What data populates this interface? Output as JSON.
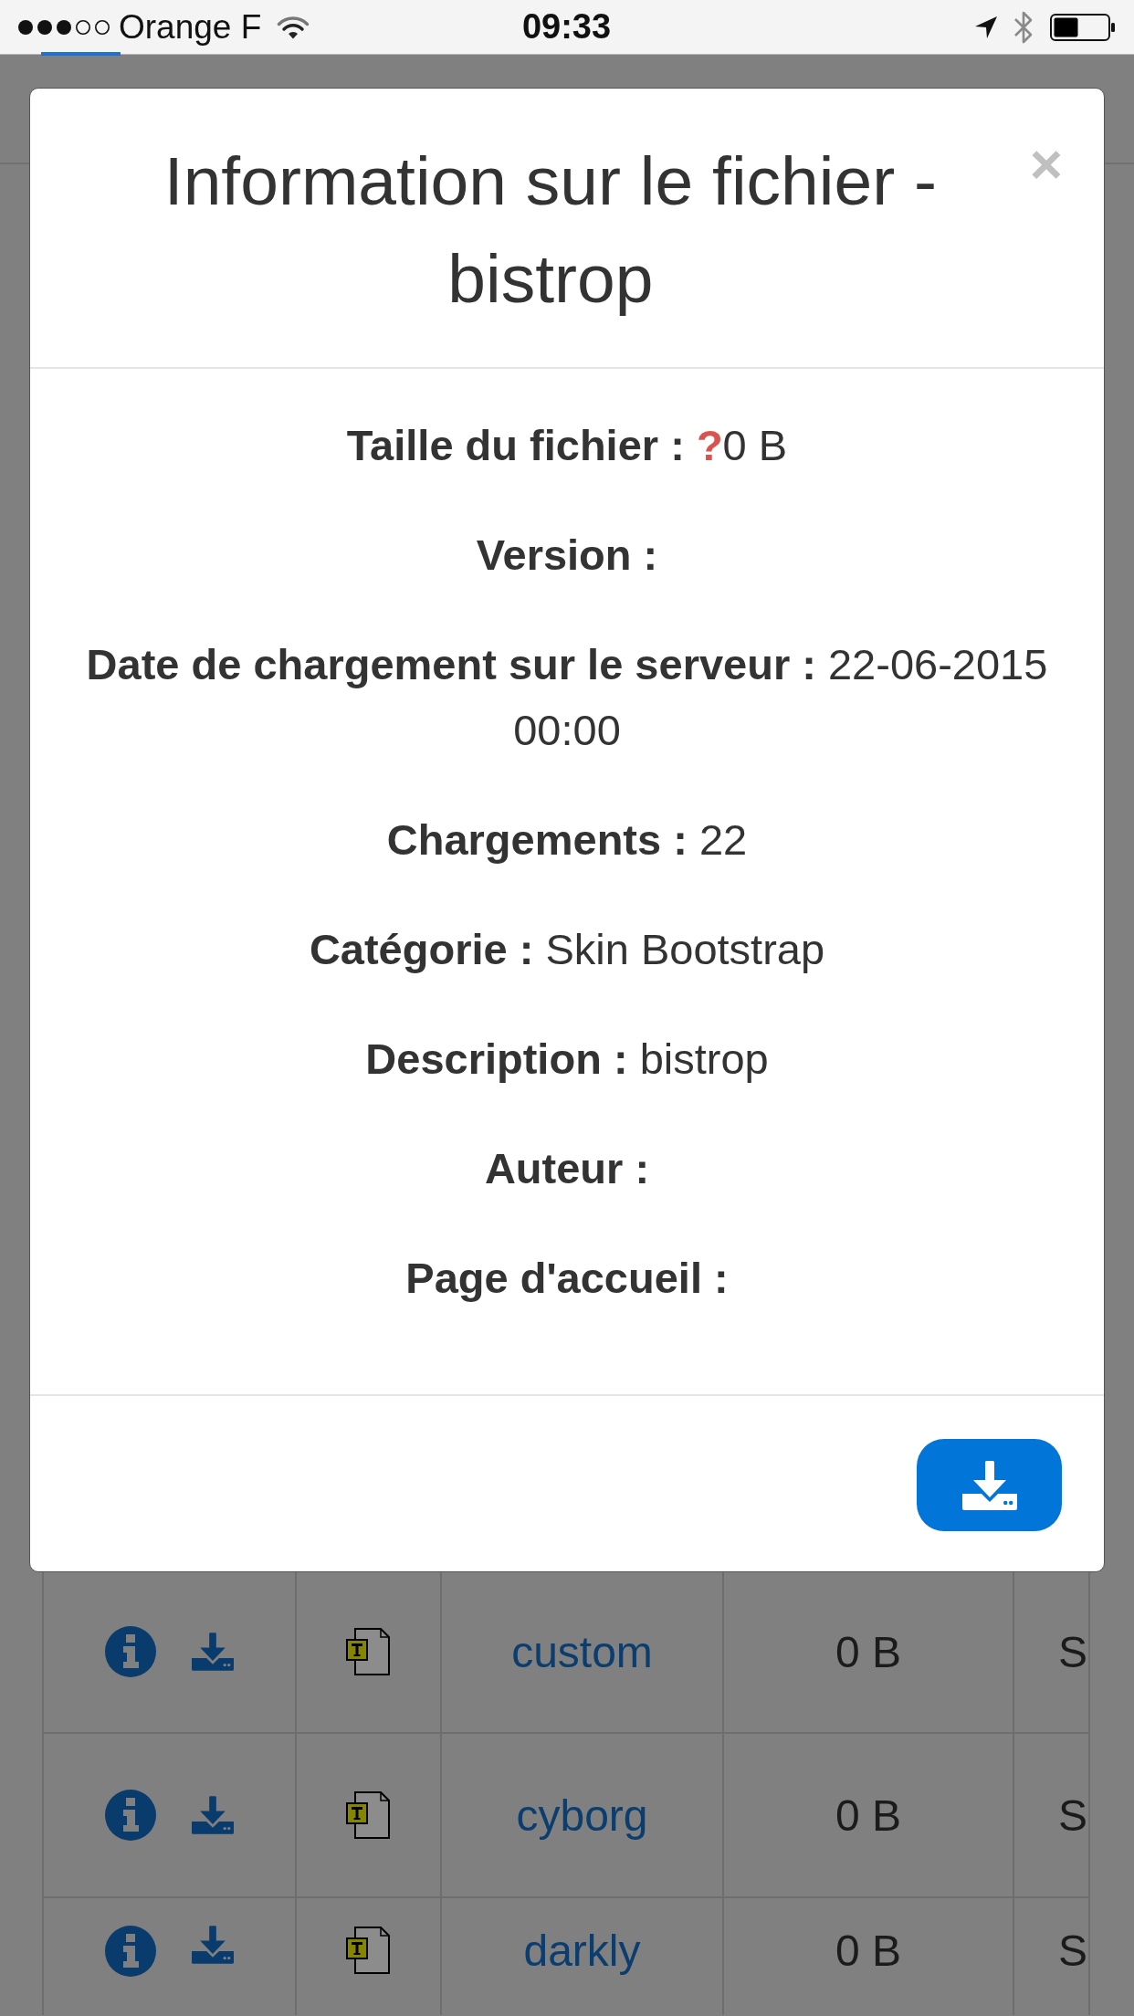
{
  "status_bar": {
    "carrier": "Orange F",
    "time": "09:33"
  },
  "modal": {
    "title": "Information sur le fichier - bistrop",
    "close": "×",
    "rows": [
      {
        "label": "Taille du fichier :",
        "icon": "?",
        "value": "0 B"
      },
      {
        "label": "Version :"
      },
      {
        "label": "Date de chargement sur le serveur :",
        "value": "22-06-2015 00:00"
      },
      {
        "label": "Chargements :",
        "value": "22"
      },
      {
        "label": "Catégorie :",
        "value": "Skin Bootstrap"
      },
      {
        "label": "Description :",
        "value": "bistrop"
      },
      {
        "label": "Auteur :"
      },
      {
        "label": "Page d'accueil :"
      }
    ]
  },
  "table": {
    "rows": [
      {
        "name": "custom",
        "size": "0 B",
        "column_5": "S"
      },
      {
        "name": "cyborg",
        "size": "0 B",
        "column_5": "S"
      },
      {
        "name": "darkly",
        "size": "0 B",
        "column_5": "S"
      }
    ]
  }
}
